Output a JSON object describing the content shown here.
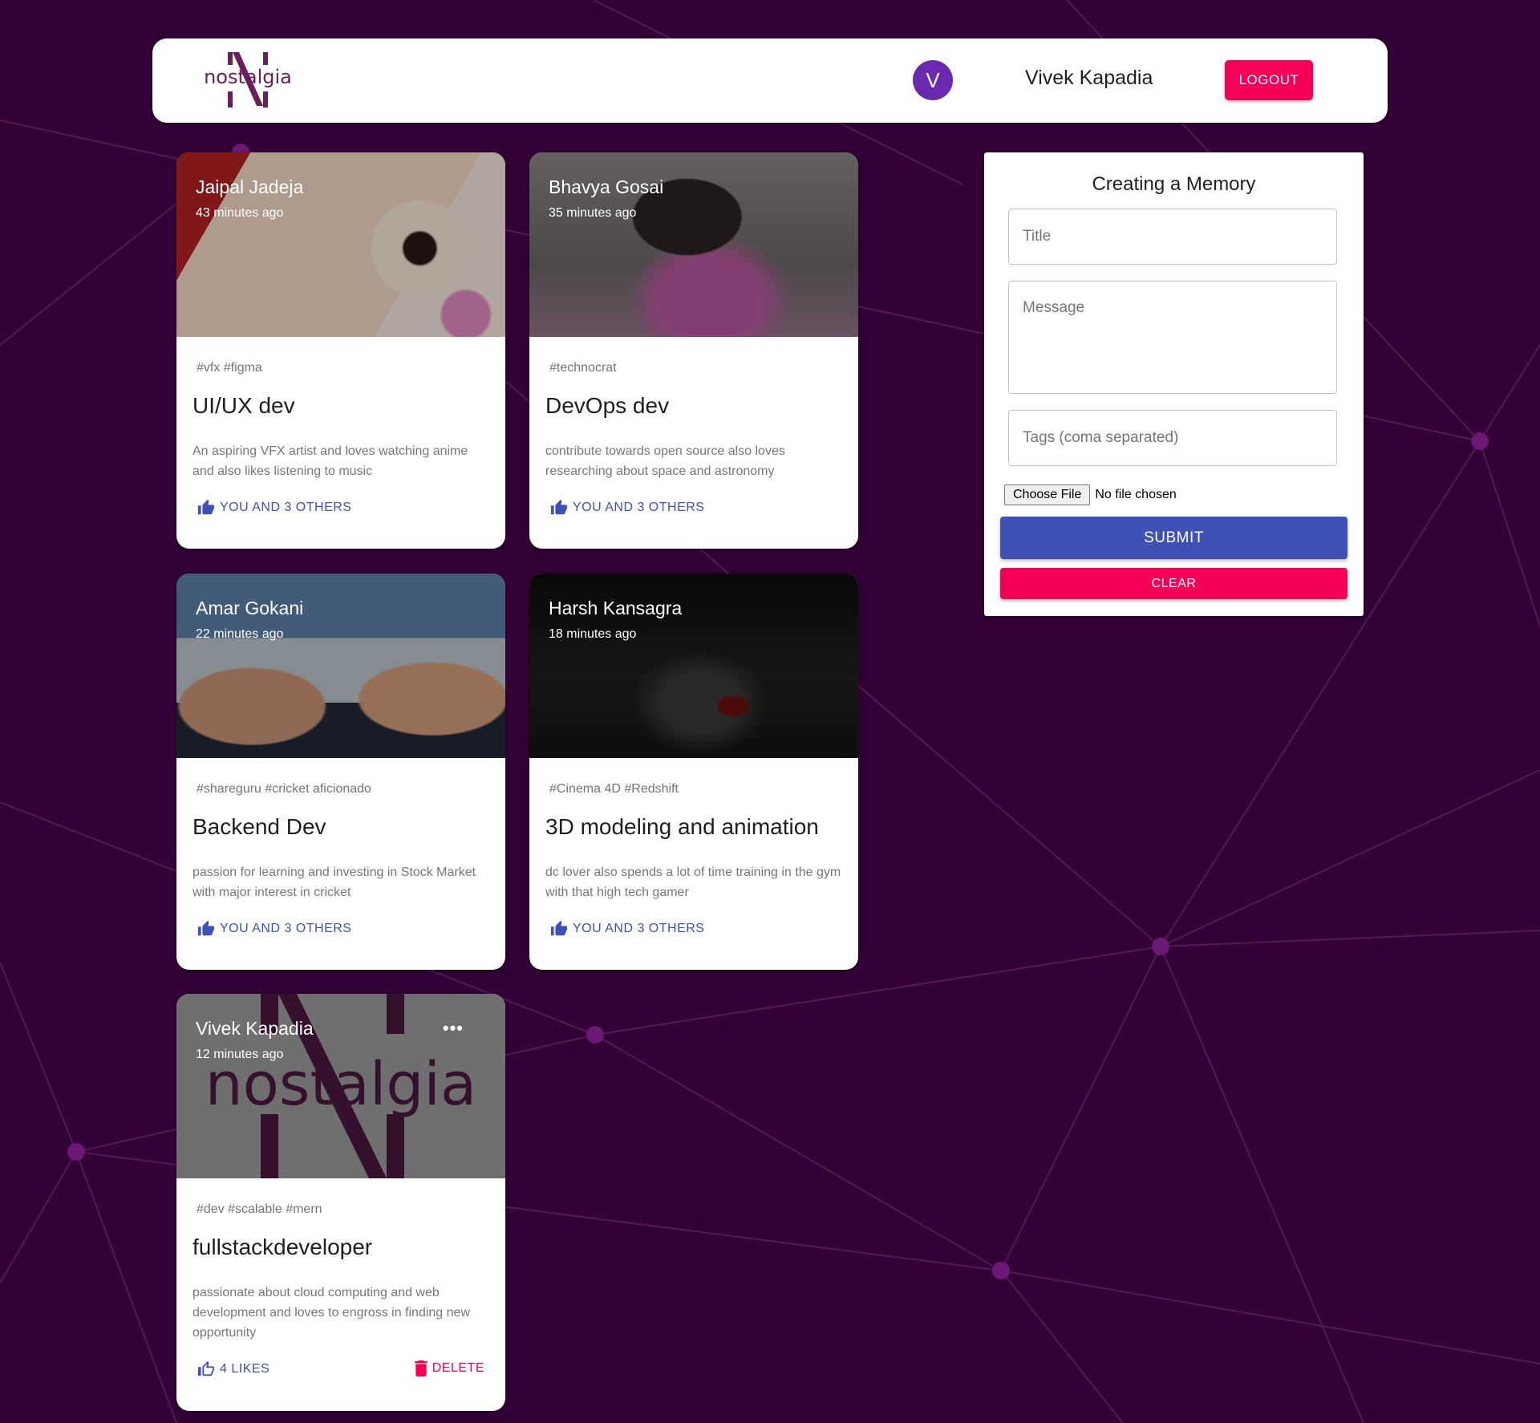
{
  "header": {
    "logo_text": "nostalgia",
    "avatar_letter": "V",
    "username": "Vivek Kapadia",
    "logout_label": "LOGOUT"
  },
  "posts": [
    {
      "author": "Jaipal Jadeja",
      "time": "43 minutes ago",
      "tags": "#vfx #figma",
      "title": "UI/UX dev",
      "message": "An aspiring VFX artist and loves watching anime and also likes listening to music",
      "likes": "YOU AND 3 OTHERS"
    },
    {
      "author": "Bhavya Gosai",
      "time": "35 minutes ago",
      "tags": "#technocrat",
      "title": "DevOps dev",
      "message": "contribute towards open source also loves researching about space and astronomy",
      "likes": "YOU AND 3 OTHERS"
    },
    {
      "author": "Amar Gokani",
      "time": "22 minutes ago",
      "tags": "#shareguru #cricket aficionado",
      "title": "Backend Dev",
      "message": "passion for learning and investing in Stock Market with major interest in cricket",
      "likes": "YOU AND 3 OTHERS"
    },
    {
      "author": "Harsh Kansagra",
      "time": "18 minutes ago",
      "tags": "#Cinema 4D #Redshift",
      "title": "3D modeling and animation",
      "message": "dc lover also spends a lot of time training in the gym with that high tech gamer",
      "likes": "YOU AND 3 OTHERS"
    },
    {
      "author": "Vivek Kapadia",
      "time": "12 minutes ago",
      "tags": "#dev #scalable #mern",
      "title": "fullstackdeveloper",
      "message": "passionate about cloud computing and web development and loves to engross in finding new opportunity",
      "likes": "4 LIKES",
      "delete_label": "DELETE",
      "more_label": "•••",
      "image_text": "nostalgia"
    }
  ],
  "form": {
    "heading": "Creating a Memory",
    "title_placeholder": "Title",
    "message_placeholder": "Message",
    "tags_placeholder": "Tags (coma separated)",
    "choose_file_label": "Choose File",
    "no_file_text": "No file chosen",
    "submit_label": "SUBMIT",
    "clear_label": "CLEAR"
  },
  "colors": {
    "background": "#320036",
    "primary": "#3f51b5",
    "secondary": "#f50057",
    "avatar": "#6a2ab0"
  },
  "icons": [
    "thumb-up-icon",
    "thumb-up-outline-icon",
    "delete-icon",
    "more-horiz-icon"
  ]
}
